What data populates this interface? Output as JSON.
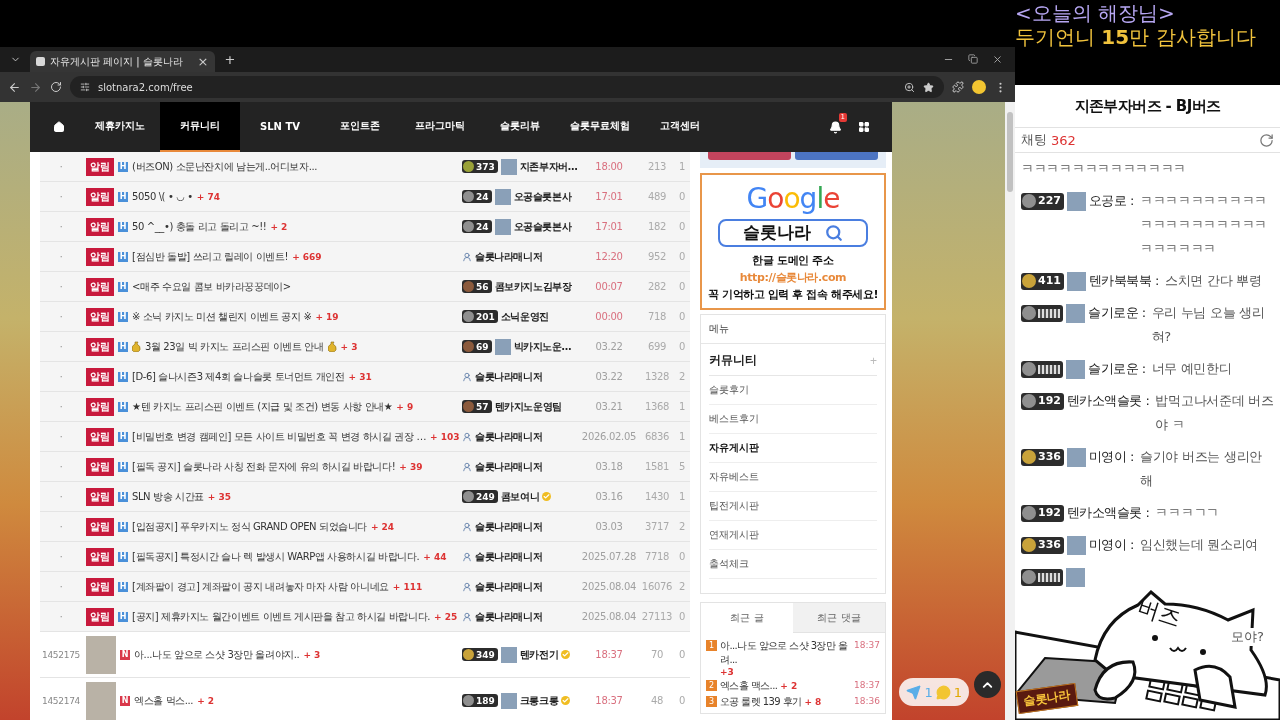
{
  "overlay": {
    "title": "<오늘의 해장님>",
    "thanks": "두기언니 **15**만 감사합니다"
  },
  "browser": {
    "tab_title": "자유게시판 페이지 | 슬롯나라",
    "tab_close": "×",
    "new_tab": "+",
    "url": "slotnara2.com/free"
  },
  "nav": {
    "items": [
      {
        "label": "제휴카지노",
        "selected": false
      },
      {
        "label": "커뮤니티",
        "selected": true
      },
      {
        "label": "SLN TV",
        "selected": false
      },
      {
        "label": "포인트존",
        "selected": false
      },
      {
        "label": "프라그마틱",
        "selected": false
      },
      {
        "label": "슬롯리뷰",
        "selected": false
      },
      {
        "label": "슬롯무료체험",
        "selected": false
      },
      {
        "label": "고객센터",
        "selected": false
      }
    ],
    "bell_count": "1"
  },
  "posts": [
    {
      "kind": "notice",
      "number": "·",
      "badge": "알림",
      "mark": "H",
      "title": "(버즈ON) 소문난잔치에 남는게..어디보자...",
      "decorated": false,
      "author": {
        "kind": "member",
        "color": "#9aa238",
        "level": "373",
        "avatar": true,
        "name": "지존부자버…",
        "verified": false
      },
      "time": "18:00",
      "today": true,
      "views": "213",
      "likes": "1"
    },
    {
      "kind": "notice",
      "number": "·",
      "badge": "알림",
      "mark": "H",
      "title": "5050 \\( • ◡ •",
      "comments": "+ 74",
      "decorated": false,
      "author": {
        "kind": "member",
        "color": "#8f8f8f",
        "level": "24",
        "avatar": true,
        "name": "오공슬롯본사",
        "verified": false
      },
      "time": "17:01",
      "today": true,
      "views": "489",
      "likes": "0"
    },
    {
      "kind": "notice",
      "number": "·",
      "badge": "알림",
      "mark": "H",
      "title": "50 ^__•)  충돌 리고 돌리고 ~!!",
      "comments": "+ 2",
      "decorated": false,
      "author": {
        "kind": "member",
        "color": "#8f8f8f",
        "level": "24",
        "avatar": true,
        "name": "오공슬롯본사",
        "verified": false
      },
      "time": "17:01",
      "today": true,
      "views": "182",
      "likes": "0"
    },
    {
      "kind": "notice",
      "number": "·",
      "badge": "알림",
      "mark": "H",
      "title": "[점심반 돌발] 쓰리고 릴레이 이벤트!",
      "comments": "+ 669",
      "decorated": false,
      "author": {
        "kind": "manager",
        "name": "슬롯나라매니저"
      },
      "time": "12:20",
      "today": true,
      "views": "952",
      "likes": "0"
    },
    {
      "kind": "notice",
      "number": "·",
      "badge": "알림",
      "mark": "H",
      "title": "<매주 수요일 콤보 바카라꿍꿍데이>",
      "decorated": false,
      "author": {
        "kind": "member",
        "color": "#8b5a3c",
        "level": "56",
        "avatar": false,
        "name": "콤보카지노김부장",
        "verified": false
      },
      "time": "00:07",
      "today": true,
      "views": "282",
      "likes": "0"
    },
    {
      "kind": "notice",
      "number": "·",
      "badge": "알림",
      "mark": "H",
      "title": "※ 소닉 카지노 미션 챌린지 이벤트 공지 ※",
      "comments": "+ 19",
      "decorated": false,
      "author": {
        "kind": "member",
        "color": "#8f8f8f",
        "level": "201",
        "avatar": false,
        "name": "소닉운영진",
        "verified": false
      },
      "time": "00:00",
      "today": true,
      "views": "718",
      "likes": "0"
    },
    {
      "kind": "notice",
      "number": "·",
      "badge": "알림",
      "mark": "H",
      "title": "3월 23일 빅 카지노 프리스핀 이벤트 안내",
      "comments": "+ 3",
      "decorated": true,
      "author": {
        "kind": "member",
        "color": "#8b5a3c",
        "level": "69",
        "avatar": true,
        "name": "빅카지노운…",
        "verified": false
      },
      "time": "03.22",
      "today": false,
      "views": "699",
      "likes": "0"
    },
    {
      "kind": "notice",
      "number": "·",
      "badge": "알림",
      "mark": "H",
      "title": "[D-6] 슬나시즌3 제4회 슬나슬롯 토너먼트 개인전",
      "comments": "+ 31",
      "decorated": false,
      "author": {
        "kind": "manager",
        "name": "슬롯나라매니저"
      },
      "time": "03.22",
      "today": false,
      "views": "1328",
      "likes": "2"
    },
    {
      "kind": "notice",
      "number": "·",
      "badge": "알림",
      "mark": "H",
      "title": "★텐 카지노 프리스핀 이벤트 (지급 및 조건) 변동 사항 안내★",
      "comments": "+ 9",
      "decorated": false,
      "author": {
        "kind": "member",
        "color": "#8b5a3c",
        "level": "57",
        "avatar": false,
        "name": "텐카지노운영팀",
        "verified": false
      },
      "time": "03.21",
      "today": false,
      "views": "1368",
      "likes": "1"
    },
    {
      "kind": "notice",
      "number": "·",
      "badge": "알림",
      "mark": "H",
      "title": "[비밀번호 변경 캠페인] 모든 사이트 비밀번호 꼭 변경 하시길 권장 …",
      "comments": "+ 103",
      "decorated": false,
      "author": {
        "kind": "manager",
        "name": "슬롯나라매니저"
      },
      "time": "2026.02.05",
      "today": false,
      "views": "6836",
      "likes": "1"
    },
    {
      "kind": "notice",
      "number": "·",
      "badge": "알림",
      "mark": "H",
      "title": "[필독 공지] 슬롯나라 사칭 전화 문자에 유의 하시길 바랍니다!",
      "comments": "+ 39",
      "decorated": false,
      "author": {
        "kind": "manager",
        "name": "슬롯나라매니저"
      },
      "time": "03.18",
      "today": false,
      "views": "1581",
      "likes": "5"
    },
    {
      "kind": "notice",
      "number": "·",
      "badge": "알림",
      "mark": "H",
      "title": "SLN 방송 시간표",
      "comments": "+ 35",
      "decorated": false,
      "author": {
        "kind": "member",
        "color": "#8f8f8f",
        "level": "249",
        "avatar": false,
        "name": "콤보여니",
        "verified": true
      },
      "time": "03.16",
      "today": false,
      "views": "1430",
      "likes": "1"
    },
    {
      "kind": "notice",
      "number": "·",
      "badge": "알림",
      "mark": "H",
      "title": "[입점공지] 푸우카지노 정식 GRAND OPEN 되었습니다",
      "comments": "+ 24",
      "decorated": false,
      "author": {
        "kind": "manager",
        "name": "슬롯나라매니저"
      },
      "time": "03.03",
      "today": false,
      "views": "3717",
      "likes": "2"
    },
    {
      "kind": "notice",
      "number": "·",
      "badge": "알림",
      "mark": "H",
      "title": "[필독공지] 특정시간 슬나 렉 발생시 WARP앱 사용하시길 바랍니다.",
      "comments": "+ 44",
      "decorated": false,
      "author": {
        "kind": "manager",
        "name": "슬롯나라매니저"
      },
      "time": "2025.07.28",
      "today": false,
      "views": "7718",
      "likes": "0"
    },
    {
      "kind": "notice",
      "number": "·",
      "badge": "알림",
      "mark": "H",
      "title": "[계좌팔이 경고] 계좌팔이 공지 내려놓자 마자 사람 아니네요",
      "comments": "+ 111",
      "decorated": false,
      "author": {
        "kind": "manager",
        "name": "슬롯나라매니저"
      },
      "time": "2025.08.04",
      "today": false,
      "views": "16076",
      "likes": "2"
    },
    {
      "kind": "notice",
      "number": "·",
      "badge": "알림",
      "mark": "H",
      "title": "[공지] 제휴카지노 월간이벤트 이벤트 게시판을 참고 하시길 바랍니다.",
      "comments": "+ 25",
      "decorated": false,
      "author": {
        "kind": "manager",
        "name": "슬롯나라매니저"
      },
      "time": "2025.08.04",
      "today": false,
      "views": "27113",
      "likes": "0"
    },
    {
      "kind": "normal",
      "number": "1452175",
      "mark": "N",
      "title": "아...나도 앞으로 스샷 3장만 올려야지..",
      "comments": "+ 3",
      "decorated": false,
      "author": {
        "kind": "member",
        "color": "#c9a33a",
        "level": "349",
        "avatar": true,
        "name": "텐카전기",
        "verified": true
      },
      "time": "18:37",
      "today": true,
      "views": "70",
      "likes": "0"
    },
    {
      "kind": "normal",
      "number": "1452174",
      "mark": "N",
      "title": "엑스홀 먹스...",
      "comments": "+ 2",
      "decorated": false,
      "author": {
        "kind": "member",
        "color": "#8f8f8f",
        "level": "189",
        "avatar": true,
        "name": "크롱크롱",
        "verified": true
      },
      "time": "18:37",
      "today": true,
      "views": "48",
      "likes": "0"
    }
  ],
  "sidebar": {
    "ad": {
      "logo": "Google",
      "query": "슬롯나라",
      "line1": "한글 도메인 주소",
      "url": "http://슬롯나라.com",
      "line2": "꼭 기억하고 입력 후 접속 해주세요!"
    },
    "menu": {
      "title": "메뉴",
      "section": "커뮤니티",
      "toggle": "+",
      "items": [
        {
          "label": "슬롯후기",
          "selected": false
        },
        {
          "label": "베스트후기",
          "selected": false
        },
        {
          "label": "자유게시판",
          "selected": true
        },
        {
          "label": "자유베스트",
          "selected": false
        },
        {
          "label": "팁전게시판",
          "selected": false
        },
        {
          "label": "연재게시판",
          "selected": false
        },
        {
          "label": "출석체크",
          "selected": false
        }
      ]
    },
    "recent": {
      "tabs": [
        {
          "label": "최근 글",
          "selected": true
        },
        {
          "label": "최근 댓글",
          "selected": false
        }
      ],
      "items": [
        {
          "rank": "1",
          "title": "아...나도 앞으로 스샷 3장만 올려...",
          "comments": "+3",
          "time": "18:37"
        },
        {
          "rank": "2",
          "title": "엑스홀 맥스...",
          "comments": "+ 2",
          "time": "18:37"
        },
        {
          "rank": "3",
          "title": "오공 룰렛 139 후기",
          "comments": "+ 8",
          "time": "18:36"
        }
      ]
    }
  },
  "floating": {
    "telegram_count": "1",
    "chat_count": "1"
  },
  "chat": {
    "title": "지존부자버즈 - BJ버즈",
    "label": "채팅",
    "count": "362",
    "messages": [
      {
        "kind": "continuation",
        "text": "ㅋㅋㅋㅋㅋㅋㅋㅋㅋㅋㅋㅋㅋ"
      },
      {
        "kind": "message",
        "color": "#8f8f8f",
        "level": "227",
        "avatar": true,
        "user": "오공로 :",
        "text": "ㅋㅋㅋㅋㅋㅋㅋㅋㅋㅋㅋㅋㅋㅋㅋㅋㅋㅋㅋㅋㅋㅋㅋㅋㅋㅋ"
      },
      {
        "kind": "message",
        "color": "#c9a33a",
        "level": "411",
        "avatar": true,
        "user": "텐카북북북 :",
        "text": "스치면 간다 뿌령"
      },
      {
        "kind": "message",
        "color": "#8f8f8f",
        "avatar": true,
        "user": "슬기로운 :",
        "text": "우리 누님 오늘 생리혀?"
      },
      {
        "kind": "message",
        "color": "#8f8f8f",
        "avatar": true,
        "user": "슬기로운 :",
        "text": "너무 예민한디"
      },
      {
        "kind": "message",
        "color": "#8f8f8f",
        "level": "192",
        "avatar": false,
        "user": "텐카소액슬롯 :",
        "text": "밥먹고나서준데 버즈야 ㅋ"
      },
      {
        "kind": "message",
        "color": "#c9a33a",
        "level": "336",
        "avatar": true,
        "user": "미영이 :",
        "text": "슬기야 버즈는 생리안해"
      },
      {
        "kind": "message",
        "color": "#8f8f8f",
        "level": "192",
        "avatar": false,
        "user": "텐카소액슬롯 :",
        "text": "ㅋㅋㅋㄱㄱ"
      },
      {
        "kind": "message",
        "color": "#c9a33a",
        "level": "336",
        "avatar": true,
        "user": "미영이 :",
        "text": "임신했는데 뭔소리여"
      },
      {
        "kind": "covered",
        "color": "#8f8f8f",
        "avatar": true,
        "text": "모야?"
      }
    ]
  },
  "cat": {
    "label": "버즈",
    "sticker": "슬롯나라"
  }
}
